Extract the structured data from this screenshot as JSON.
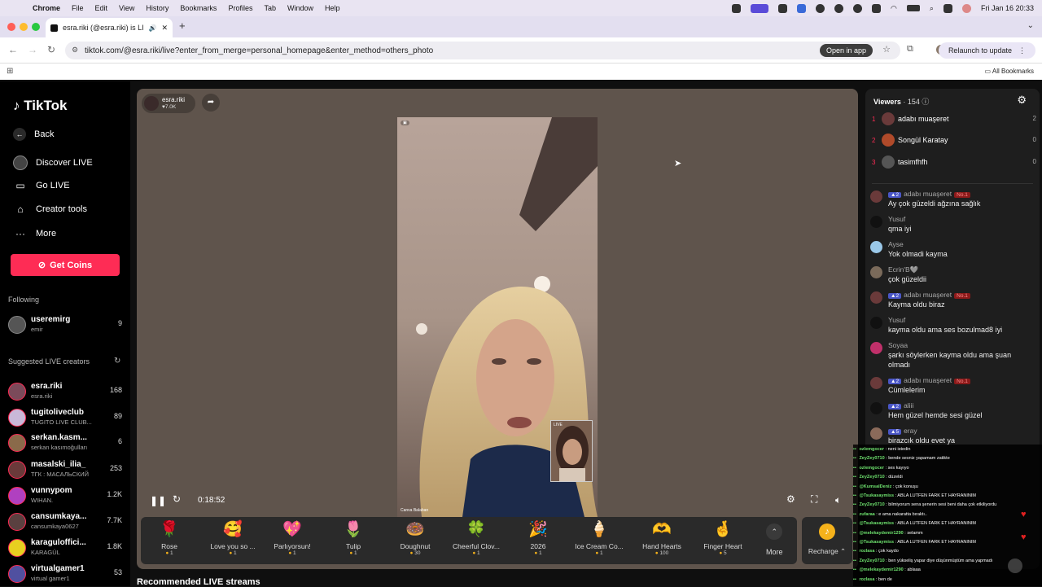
{
  "menubar": {
    "app": "Chrome",
    "items": [
      "File",
      "Edit",
      "View",
      "History",
      "Bookmarks",
      "Profiles",
      "Tab",
      "Window",
      "Help"
    ],
    "datetime": "Fri Jan 16  20:33"
  },
  "tab": {
    "title": "esra.riki (@esra.riki) is LIV"
  },
  "address": {
    "url": "tiktok.com/@esra.riki/live?enter_from_merge=personal_homepage&enter_method=others_photo",
    "open_in_app": "Open in app",
    "relaunch": "Relaunch to update"
  },
  "bookmarks": {
    "all": "All Bookmarks"
  },
  "sidebar": {
    "logo": "TikTok",
    "back": "Back",
    "nav": [
      {
        "label": "Discover LIVE"
      },
      {
        "label": "Go LIVE"
      },
      {
        "label": "Creator tools"
      },
      {
        "label": "More"
      }
    ],
    "get_coins": "Get Coins",
    "following_title": "Following",
    "following": [
      {
        "name": "useremirg",
        "sub": "emir",
        "count": "9"
      }
    ],
    "suggested_title": "Suggested LIVE creators",
    "suggested": [
      {
        "name": "esra.riki",
        "sub": "esra.riki",
        "count": "168",
        "color": "#7b4a5a"
      },
      {
        "name": "tugitoliveclub",
        "sub": "TUGITO LIVE CLUB...",
        "count": "89",
        "color": "#c9b8d8"
      },
      {
        "name": "serkan.kasm...",
        "sub": "serkan kasımoğulları",
        "count": "6",
        "color": "#8a6a4a"
      },
      {
        "name": "masalski_ilia_",
        "sub": "ТГК : МАСАЛЬСКИЙ",
        "count": "253",
        "color": "#6a3a3a"
      },
      {
        "name": "vunnypom",
        "sub": "WIHAN.",
        "count": "1.2K",
        "color": "#b040c0"
      },
      {
        "name": "cansumkaya...",
        "sub": "cansumkaya0627",
        "count": "7.7K",
        "color": "#5a4040"
      },
      {
        "name": "karaguloffici...",
        "sub": "KARAGÜL",
        "count": "1.8K",
        "color": "#e8d020"
      },
      {
        "name": "virtualgamer1",
        "sub": "virtual gamer1",
        "count": "53",
        "color": "#5050a0"
      }
    ]
  },
  "stage": {
    "host_name": "esra.riki",
    "host_likes": "7.0K",
    "time": "0:18:52",
    "video_caption": "Canva Balaban",
    "pip_label": "LIVE"
  },
  "gifts": [
    {
      "name": "Rose",
      "price": "1",
      "icon": "🌹"
    },
    {
      "name": "Love you so ...",
      "price": "1",
      "icon": "🥰"
    },
    {
      "name": "Parlıyorsun!",
      "price": "1",
      "icon": "💖"
    },
    {
      "name": "Tulip",
      "price": "1",
      "icon": "🌷"
    },
    {
      "name": "Doughnut",
      "price": "30",
      "icon": "🍩"
    },
    {
      "name": "Cheerful Clov...",
      "price": "1",
      "icon": "🍀"
    },
    {
      "name": "2026",
      "price": "1",
      "icon": "🎉"
    },
    {
      "name": "Ice Cream Co...",
      "price": "1",
      "icon": "🍦"
    },
    {
      "name": "Hand Hearts",
      "price": "100",
      "icon": "🫶"
    },
    {
      "name": "Finger Heart",
      "price": "5",
      "icon": "🤞"
    }
  ],
  "gifts_more": "More",
  "recharge": "Recharge",
  "recommended": "Recommended LIVE streams",
  "viewers": {
    "title": "Viewers",
    "count": "· 154",
    "list": [
      {
        "rank": "1",
        "name": "adabı muaşeret",
        "count": "2"
      },
      {
        "rank": "2",
        "name": "Songül Karatay",
        "count": "0"
      },
      {
        "rank": "3",
        "name": "tasimfhfh",
        "count": "0"
      }
    ]
  },
  "chat": [
    {
      "user": "adabı muaşeret",
      "level": "2",
      "no1": "No.1",
      "text": "Ay çok güzeldi ağzına sağlık"
    },
    {
      "user": "Yusuf",
      "level": "",
      "no1": "",
      "text": "qma iyi"
    },
    {
      "user": "Ayse",
      "level": "",
      "no1": "",
      "text": "Yok olmadi kayma"
    },
    {
      "user": "Ecrin'B🩶",
      "level": "",
      "no1": "",
      "text": "çok güzeldii"
    },
    {
      "user": "adabı muaşeret",
      "level": "2",
      "no1": "No.1",
      "text": "Kayma oldu biraz"
    },
    {
      "user": "Yusuf",
      "level": "",
      "no1": "",
      "text": "kayma oldu ama ses bozulmad8 iyi"
    },
    {
      "user": "Soyaa",
      "level": "",
      "no1": "",
      "text": "şarkı söylerken kayma oldu ama şuan olmadı"
    },
    {
      "user": "adabı muaşeret",
      "level": "2",
      "no1": "No.1",
      "text": "Cümlelerim"
    },
    {
      "user": "aliii",
      "level": "2",
      "no1": "",
      "text": "Hem güzel hemde sesi güzel"
    },
    {
      "user": "eray",
      "level": "5",
      "no1": "",
      "text": "birazcık oldu evet ya"
    }
  ],
  "overlay": [
    {
      "user": "ozlemgocer",
      "text": "neni istedin"
    },
    {
      "user": "ZeyZey0710",
      "text": "bende sesniz yapamam zatikte"
    },
    {
      "user": "ozlemgocer",
      "text": "ses kayıyo"
    },
    {
      "user": "ZeyZey0710",
      "text": "düzeldi"
    },
    {
      "user": "@KumsalDeniz",
      "text": "çok konuşu"
    },
    {
      "user": "@Tsukasaymiss",
      "text": "ABLA LÜTFEN FARK ET HAYRANINIM"
    },
    {
      "user": "ZeyZey0710",
      "text": "bilmiyorum sena şenerin sesi beni daha çok etkiliyordu"
    },
    {
      "user": "zufaraa",
      "text": "e ama nakaratta bıraktı.."
    },
    {
      "user": "@Tsukasaymiss",
      "text": "ABLA LÜTFEN FARK ET HAYRANINIM"
    },
    {
      "user": "@melekaydemir1290",
      "text": "selamm"
    },
    {
      "user": "@Tsukasaymiss",
      "text": "ABLA LÜTFEN FARK ET HAYRANINIM"
    },
    {
      "user": "rozlasa",
      "text": "çok kaydo"
    },
    {
      "user": "ZeyZey0710",
      "text": "ben yükseliş yapar diye düşünmüştüm ama yapmadı"
    },
    {
      "user": "@melekaydemir1290",
      "text": "ablaaa"
    },
    {
      "user": "rozlasa",
      "text": "ben de"
    }
  ],
  "colors": {
    "accent": "#fe2c55",
    "stage": "#5f544c",
    "panel": "#1e1e1e"
  }
}
